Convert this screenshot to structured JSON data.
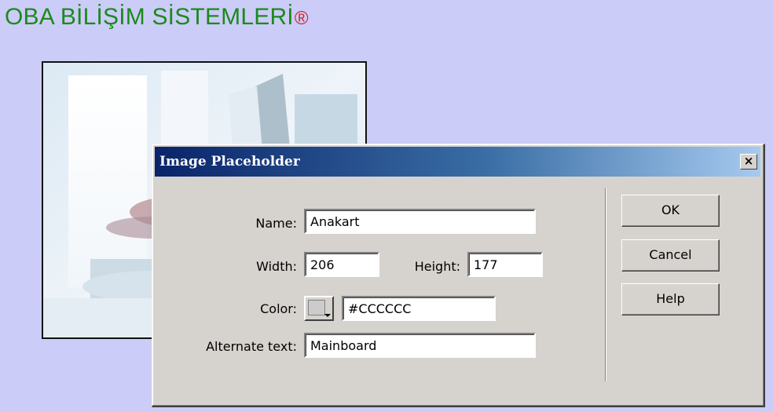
{
  "page": {
    "title": "OBA BİLİŞİM SİSTEMLERİ",
    "registered_mark": "®"
  },
  "dialog": {
    "title": "Image Placeholder",
    "close_label": "×",
    "name_label": "Name:",
    "name_value": "Anakart",
    "width_label": "Width:",
    "width_value": "206",
    "height_label": "Height:",
    "height_value": "177",
    "color_label": "Color:",
    "color_value": "#CCCCCC",
    "alt_label": "Alternate text:",
    "alt_value": "Mainboard",
    "buttons": {
      "ok": "OK",
      "cancel": "Cancel",
      "help": "Help"
    }
  },
  "colors": {
    "page_background": "#ccccf8",
    "title_green": "#1c8a1c",
    "dialog_face": "#d6d3ce",
    "titlebar_start": "#0a246a",
    "titlebar_end": "#a6caf0",
    "swatch": "#cccccc"
  }
}
